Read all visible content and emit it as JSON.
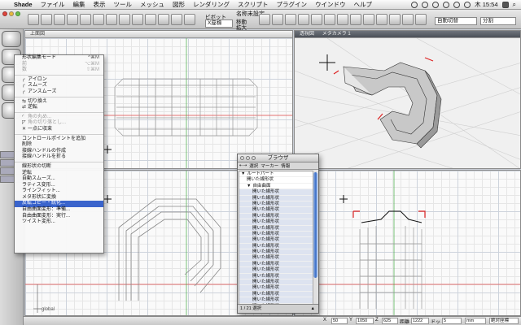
{
  "menubar": {
    "app": "Shade",
    "items": [
      "ファイル",
      "編集",
      "表示",
      "ツール",
      "メッシュ",
      "図形",
      "レンダリング",
      "スクリプト",
      "プラグイン",
      "ウインドウ",
      "ヘルプ"
    ],
    "clock": "木 15:54"
  },
  "window": {
    "title": "名称未設定"
  },
  "toolbar": {
    "pivot_label": "ピボット",
    "pivot_value": "X座標",
    "move_label": "移動",
    "scale_label": "拡大",
    "view_switch": "自動切替",
    "split_value": "分割"
  },
  "views": {
    "top_left": "上面図",
    "top_right_a": "透視図",
    "top_right_b": "メタカメラ 1",
    "bottom_axis_label": "global"
  },
  "context_menu": {
    "items": [
      {
        "label": "形状編集モード",
        "shortcut": "^⌘M",
        "disabled": false,
        "icon": ""
      },
      {
        "label": "前",
        "shortcut": "⌥⌘M",
        "disabled": true,
        "icon": ""
      },
      {
        "label": "数",
        "shortcut": "⇧⌘M",
        "disabled": true,
        "icon": ""
      },
      {
        "sep": true
      },
      {
        "label": "アイロン",
        "shortcut": "",
        "disabled": false,
        "icon": "╭"
      },
      {
        "label": "スムーズ",
        "shortcut": "",
        "disabled": false,
        "icon": "╭"
      },
      {
        "label": "アンスムーズ",
        "shortcut": "",
        "disabled": false,
        "icon": "╭"
      },
      {
        "sep": true
      },
      {
        "label": "切り換え",
        "shortcut": "",
        "disabled": false,
        "icon": "⇆"
      },
      {
        "label": "逆転",
        "shortcut": "",
        "disabled": false,
        "icon": "⇄"
      },
      {
        "sep": true
      },
      {
        "label": "角の丸め...",
        "shortcut": "",
        "disabled": true,
        "icon": "◜"
      },
      {
        "label": "角の切り落とし...",
        "shortcut": "",
        "disabled": true,
        "icon": "◸"
      },
      {
        "label": "一点に収束",
        "shortcut": "",
        "disabled": false,
        "icon": "✕"
      },
      {
        "sep": true
      },
      {
        "label": "コントロールポイントを追加",
        "shortcut": "",
        "disabled": false,
        "icon": ""
      },
      {
        "label": "削除",
        "shortcut": "",
        "disabled": false,
        "icon": ""
      },
      {
        "label": "接線ハンドルの作成",
        "shortcut": "",
        "disabled": false,
        "icon": ""
      },
      {
        "label": "接線ハンドルを折る",
        "shortcut": "",
        "disabled": false,
        "icon": ""
      },
      {
        "sep": true
      },
      {
        "label": "線形状の切断",
        "shortcut": "",
        "disabled": false,
        "icon": ""
      },
      {
        "label": "逆転",
        "shortcut": "",
        "disabled": false,
        "icon": ""
      },
      {
        "label": "自動スムーズ...",
        "shortcut": "",
        "disabled": false,
        "icon": ""
      },
      {
        "label": "ラティス変形...",
        "shortcut": "",
        "disabled": false,
        "icon": ""
      },
      {
        "label": "ラインフィット...",
        "shortcut": "",
        "disabled": false,
        "icon": ""
      },
      {
        "label": "メタ形状に変換",
        "shortcut": "",
        "disabled": false,
        "icon": ""
      },
      {
        "label": "反転コピー・統化...",
        "shortcut": "",
        "disabled": false,
        "icon": "",
        "selected": true
      },
      {
        "label": "自由曲面変形：準備...",
        "shortcut": "",
        "disabled": false,
        "icon": ""
      },
      {
        "label": "自由曲面変形：実行...",
        "shortcut": "",
        "disabled": false,
        "icon": ""
      },
      {
        "label": "ツイスト変形...",
        "shortcut": "",
        "disabled": false,
        "icon": ""
      }
    ]
  },
  "browser": {
    "title": "ブラウザ",
    "toolbar": [
      "選択",
      "マーカー",
      "情報"
    ],
    "tree": [
      {
        "label": "ルートパート",
        "indent": 0,
        "arrow": "▼"
      },
      {
        "label": "開いた線形状",
        "indent": 1,
        "arrow": ""
      },
      {
        "label": "自由曲面",
        "indent": 1,
        "arrow": "▼"
      },
      {
        "label": "開いた線形状",
        "indent": 2,
        "arrow": ""
      },
      {
        "label": "開いた線形状",
        "indent": 2,
        "arrow": ""
      },
      {
        "label": "開いた線形状",
        "indent": 2,
        "arrow": ""
      },
      {
        "label": "開いた線形状",
        "indent": 2,
        "arrow": ""
      },
      {
        "label": "開いた線形状",
        "indent": 2,
        "arrow": ""
      },
      {
        "label": "開いた線形状",
        "indent": 2,
        "arrow": ""
      },
      {
        "label": "開いた線形状",
        "indent": 2,
        "arrow": ""
      },
      {
        "label": "開いた線形状",
        "indent": 2,
        "arrow": ""
      },
      {
        "label": "開いた線形状",
        "indent": 2,
        "arrow": ""
      },
      {
        "label": "開いた線形状",
        "indent": 2,
        "arrow": ""
      },
      {
        "label": "開いた線形状",
        "indent": 2,
        "arrow": ""
      },
      {
        "label": "開いた線形状",
        "indent": 2,
        "arrow": ""
      },
      {
        "label": "開いた線形状",
        "indent": 2,
        "arrow": ""
      },
      {
        "label": "開いた線形状",
        "indent": 2,
        "arrow": ""
      },
      {
        "label": "開いた線形状",
        "indent": 2,
        "arrow": ""
      },
      {
        "label": "開いた線形状",
        "indent": 2,
        "arrow": ""
      },
      {
        "label": "開いた線形状",
        "indent": 2,
        "arrow": ""
      },
      {
        "label": "開いた線形状",
        "indent": 2,
        "arrow": ""
      },
      {
        "label": "開いた線形状",
        "indent": 2,
        "arrow": ""
      },
      {
        "label": "開いた線形状",
        "indent": 2,
        "arrow": ""
      }
    ],
    "status": "1 / 21 選択"
  },
  "statusbar": {
    "x_label": "X",
    "x_value": "50",
    "y_label": "Y",
    "y_value": "1050",
    "z_label": "Z",
    "z_value": "625",
    "dist_label": "距離",
    "dist_value": "1222",
    "dot_label": "ドット",
    "dot_value": "5",
    "unit_value": "mm",
    "mode_value": "絶対座標"
  }
}
